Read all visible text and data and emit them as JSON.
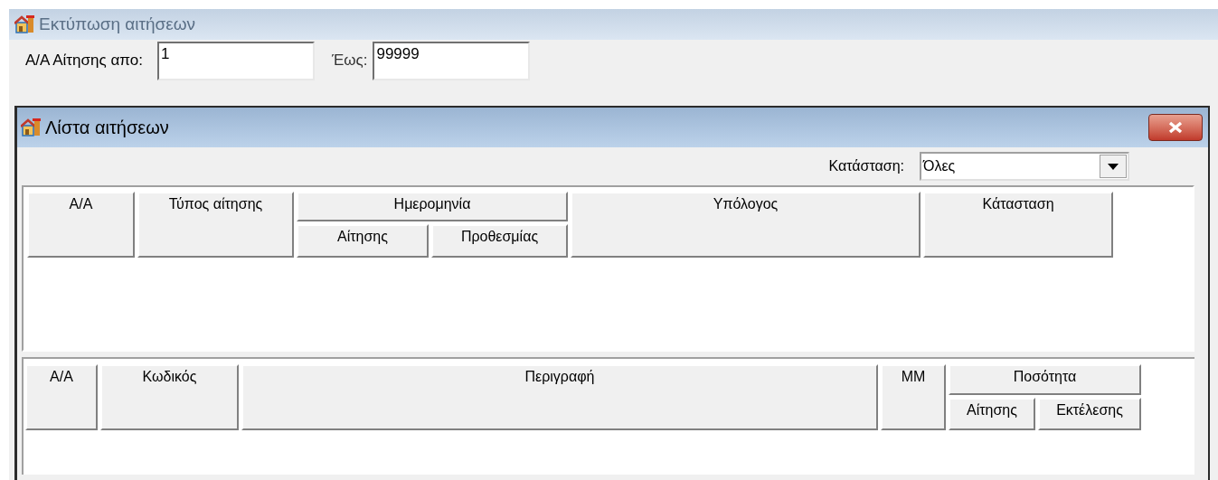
{
  "window": {
    "title": "Εκτύπωση αιτήσεων"
  },
  "filters": [
    {
      "label": "Α/Α Αίτησης απο:",
      "value": "1"
    },
    {
      "label": "Έως:",
      "value": "99999"
    }
  ],
  "dialog": {
    "title": "Λίστα αιτήσεων",
    "status_filter": {
      "label": "Κατάσταση:",
      "value": "Όλες"
    },
    "requests_table": {
      "columns": [
        {
          "label": "Α/Α"
        },
        {
          "label": "Τύπος αίτησης"
        },
        {
          "label": "Ημερομηνία",
          "children": [
            {
              "label": "Αίτησης"
            },
            {
              "label": "Προθεσμίας"
            }
          ]
        },
        {
          "label": "Υπόλογος"
        },
        {
          "label": "Κάτασταση"
        }
      ]
    },
    "items_table": {
      "columns": [
        {
          "label": "Α/Α"
        },
        {
          "label": "Κωδικός"
        },
        {
          "label": "Περιγραφή"
        },
        {
          "label": "ΜΜ"
        },
        {
          "label": "Ποσότητα",
          "children": [
            {
              "label": "Αίτησης"
            },
            {
              "label": "Εκτέλεσης"
            }
          ]
        }
      ]
    }
  }
}
